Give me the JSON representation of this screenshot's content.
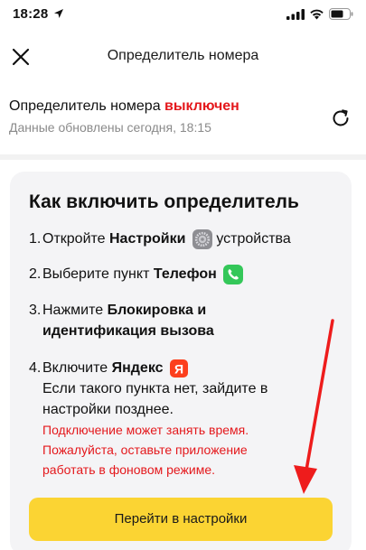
{
  "status_bar": {
    "time": "18:28"
  },
  "header": {
    "title": "Определитель номера"
  },
  "status": {
    "label": "Определитель номера",
    "state": "выключен",
    "updated": "Данные обновлены сегодня, 18:15"
  },
  "card": {
    "title": "Как включить определитель",
    "steps": [
      {
        "num": "1.",
        "pre": "Откройте ",
        "bold": "Настройки",
        "post": " устройства",
        "icon": "settings-icon"
      },
      {
        "num": "2.",
        "pre": "Выберите пункт ",
        "bold": "Телефон",
        "icon": "phone-app-icon"
      },
      {
        "num": "3.",
        "pre": "Нажмите ",
        "bold_line1": "Блокировка и",
        "bold_line2": "идентификация вызова"
      },
      {
        "num": "4.",
        "pre": "Включите ",
        "bold": "Яндекс",
        "icon": "yandex-app-icon",
        "line2": "Если такого пункта нет, зайдите в",
        "line3": "настройки позднее."
      }
    ],
    "warning": [
      "Подключение может занять время.",
      "Пожалуйста, оставьте приложение",
      "работать в фоновом режиме."
    ],
    "button_label": "Перейти в настройки"
  },
  "colors": {
    "accent_red": "#e4181c",
    "button_yellow": "#fbd433",
    "card_bg": "#f4f4f6"
  }
}
